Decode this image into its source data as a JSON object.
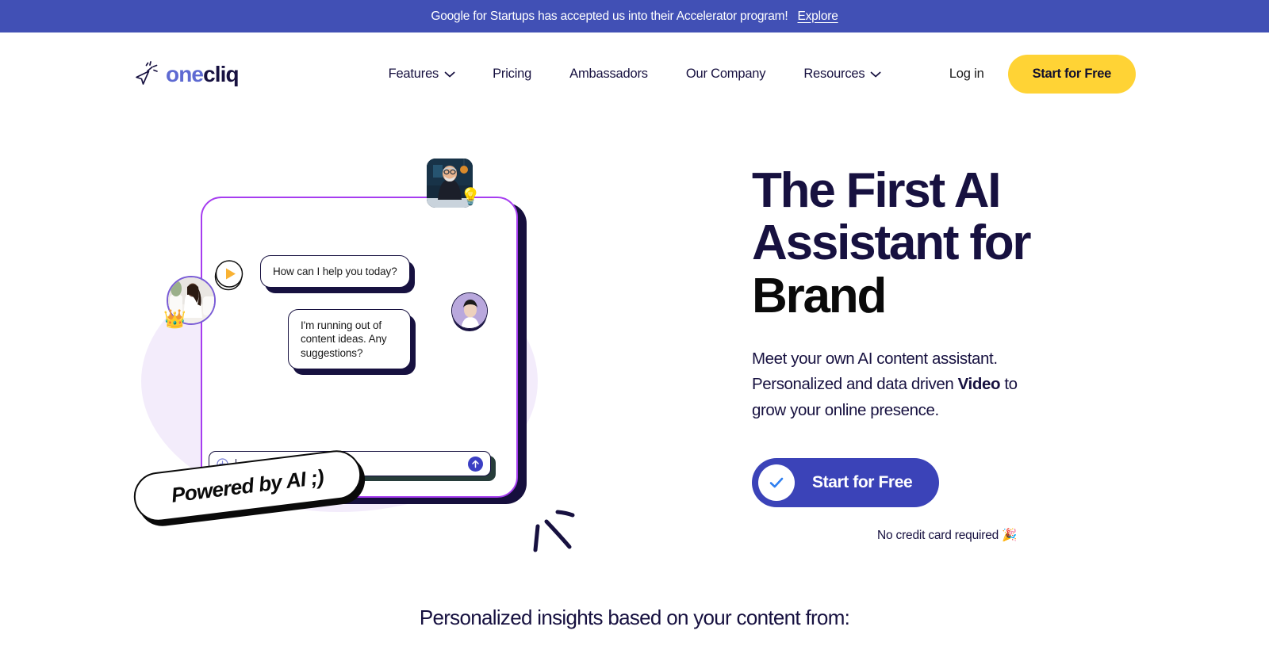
{
  "announcement": {
    "message": "Google for Startups has accepted us into their Accelerator program!",
    "link_label": "Explore",
    "bg_color": "#4150b5"
  },
  "nav": {
    "logo": {
      "part1": "one",
      "part2": "cliq",
      "icon": "cursor-sparkle-icon"
    },
    "links": [
      {
        "label": "Features",
        "has_dropdown": true
      },
      {
        "label": "Pricing",
        "has_dropdown": false
      },
      {
        "label": "Ambassadors",
        "has_dropdown": false
      },
      {
        "label": "Our Company",
        "has_dropdown": false
      },
      {
        "label": "Resources",
        "has_dropdown": true
      }
    ],
    "login_label": "Log in",
    "cta_label": "Start for Free",
    "cta_color": "#ffd335"
  },
  "hero": {
    "headline_line1": "The First AI",
    "headline_line2": "Assistant for",
    "headline_line3": "Brand",
    "sub_part1": "Meet your own AI content assistant. Personalized and data driven ",
    "sub_bold": "Video",
    "sub_part2": " to grow your online presence.",
    "cta_label": "Start for Free",
    "cta_color": "#3b43b8",
    "note": "No credit card required 🎉"
  },
  "illustration": {
    "messages": [
      {
        "from": "assistant",
        "text": "How can I help you today?"
      },
      {
        "from": "user",
        "text": "I'm running out of content ideas. Any suggestions?"
      }
    ],
    "badge_label": "Powered by AI ;)",
    "crown_emoji": "👑",
    "bulb_emoji": "💡",
    "frame_color": "#a63df0",
    "shadow_color": "#160f3d",
    "input_placeholder": ""
  },
  "bottom": {
    "heading": "Personalized insights based on your content from:"
  }
}
